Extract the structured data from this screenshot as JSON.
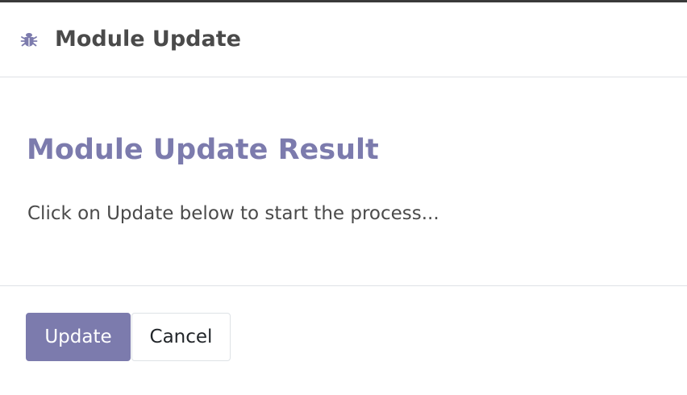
{
  "dialog": {
    "title": "Module Update",
    "title_icon": "bug-icon",
    "body_title": "Module Update Result",
    "body_text": "Click on Update below to start the process..."
  },
  "buttons": {
    "update_label": "Update",
    "cancel_label": "Cancel"
  },
  "colors": {
    "accent": "#7c7bad",
    "heading_text": "#4a4a4a",
    "divider": "#dee2e6"
  }
}
